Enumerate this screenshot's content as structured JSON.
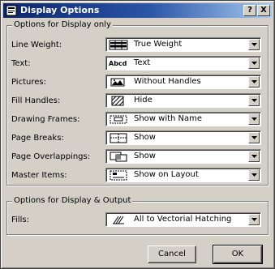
{
  "window": {
    "title": "Display Options"
  },
  "titlebar": {
    "help_label": "?",
    "close_label": "X"
  },
  "display_only": {
    "title": "Options for Display only",
    "rows": [
      {
        "label": "Line Weight:",
        "value": "True Weight",
        "icon": "line-weight-icon"
      },
      {
        "label": "Text:",
        "value": "Text",
        "icon": "text-sample-icon",
        "icon_text": "Abcd"
      },
      {
        "label": "Pictures:",
        "value": "Without Handles",
        "icon": "picture-icon"
      },
      {
        "label": "Fill Handles:",
        "value": "Hide",
        "icon": "fill-hatch-icon"
      },
      {
        "label": "Drawing Frames:",
        "value": "Show with Name",
        "icon": "drawing-frame-icon"
      },
      {
        "label": "Page Breaks:",
        "value": "Show",
        "icon": "page-break-icon"
      },
      {
        "label": "Page Overlappings:",
        "value": "Show",
        "icon": "page-overlap-icon"
      },
      {
        "label": "Master Items:",
        "value": "Show on Layout",
        "icon": "master-items-icon"
      }
    ]
  },
  "display_output": {
    "title": "Options for Display & Output",
    "fills": {
      "label": "Fills:",
      "value": "All to Vectorial Hatching",
      "icon": "vectorial-hatch-icon"
    }
  },
  "buttons": {
    "cancel_label": "Cancel",
    "ok_label": "OK"
  },
  "colors": {
    "title_start": "#0a246a",
    "title_end": "#a6caf0",
    "face": "#d4d0c8"
  }
}
